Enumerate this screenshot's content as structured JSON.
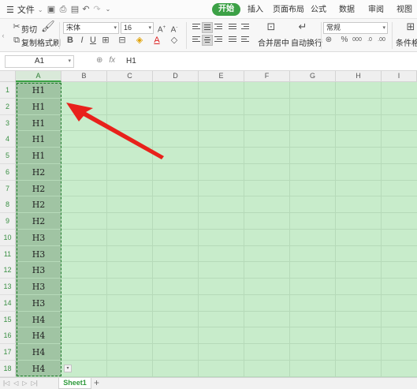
{
  "menubar": {
    "file_menu": "文件",
    "tabs": [
      "开始",
      "插入",
      "页面布局",
      "公式",
      "数据",
      "审阅",
      "视图"
    ],
    "active_tab": "开始"
  },
  "ribbon": {
    "cut": "剪切",
    "copy": "复制",
    "format_painter": "格式刷",
    "font_name": "宋体",
    "font_size": "16",
    "merge_center": "合并居中",
    "wrap_text": "自动换行",
    "number_format": "常规",
    "conditional_format": "条件格式"
  },
  "formula_bar": {
    "name_box": "A1",
    "formula": "H1"
  },
  "grid": {
    "columns": [
      "A",
      "B",
      "C",
      "D",
      "E",
      "F",
      "G",
      "H",
      "I"
    ],
    "rows": [
      "1",
      "2",
      "3",
      "4",
      "5",
      "6",
      "7",
      "8",
      "9",
      "10",
      "11",
      "12",
      "13",
      "14",
      "15",
      "16",
      "17",
      "18"
    ],
    "col_a_values": [
      "H1",
      "H1",
      "H1",
      "H1",
      "H1",
      "H2",
      "H2",
      "H2",
      "H2",
      "H3",
      "H3",
      "H3",
      "H3",
      "H3",
      "H4",
      "H4",
      "H4",
      "H4"
    ]
  },
  "sheets": {
    "active": "Sheet1"
  },
  "colors": {
    "accent": "#3ca146",
    "cell_bg": "#c8eccb",
    "selected_col_bg": "#a0c4a3",
    "arrow": "#e8211b"
  }
}
